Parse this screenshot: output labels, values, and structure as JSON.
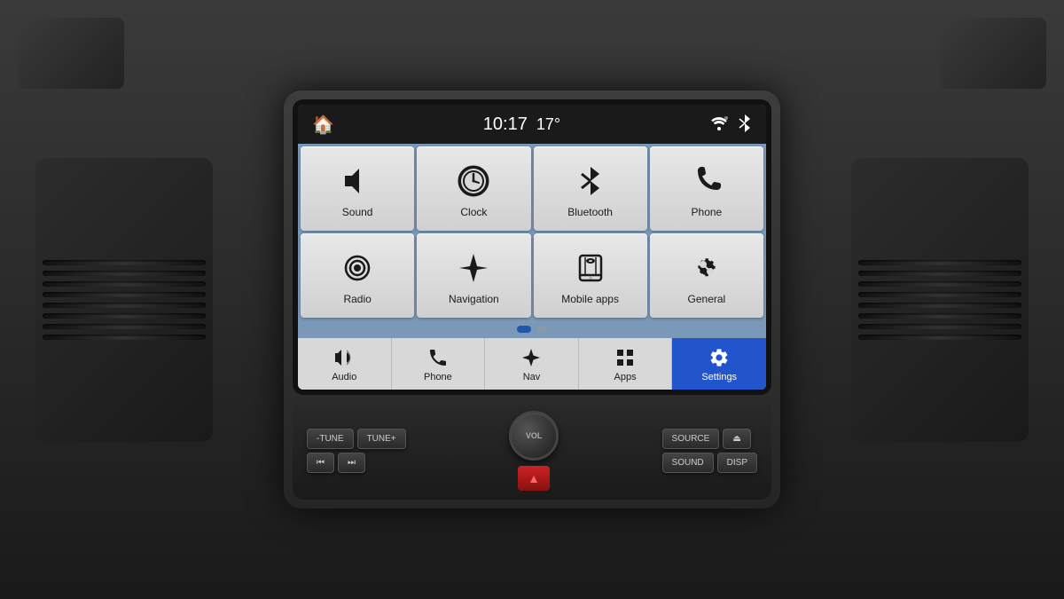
{
  "screen": {
    "header": {
      "home_label": "🏠",
      "time": "10:17",
      "temperature": "17°",
      "wifi_icon": "wifi",
      "bluetooth_icon": "bluetooth"
    },
    "app_grid": {
      "tiles": [
        {
          "id": "sound",
          "label": "Sound",
          "icon": "sound"
        },
        {
          "id": "clock",
          "label": "Clock",
          "icon": "clock"
        },
        {
          "id": "bluetooth",
          "label": "Bluetooth",
          "icon": "bluetooth"
        },
        {
          "id": "phone",
          "label": "Phone",
          "icon": "phone"
        },
        {
          "id": "radio",
          "label": "Radio",
          "icon": "radio"
        },
        {
          "id": "navigation",
          "label": "Navigation",
          "icon": "navigation"
        },
        {
          "id": "mobile-apps",
          "label": "Mobile apps",
          "icon": "mobile-apps"
        },
        {
          "id": "general",
          "label": "General",
          "icon": "general"
        }
      ]
    },
    "pagination": {
      "dots": [
        {
          "active": true
        },
        {
          "active": false
        }
      ]
    },
    "bottom_nav": {
      "items": [
        {
          "id": "audio",
          "label": "Audio",
          "icon": "audio",
          "active": false
        },
        {
          "id": "phone",
          "label": "Phone",
          "icon": "phone-nav",
          "active": false
        },
        {
          "id": "nav",
          "label": "Nav",
          "icon": "nav-star",
          "active": false
        },
        {
          "id": "apps",
          "label": "Apps",
          "icon": "apps-grid",
          "active": false
        },
        {
          "id": "settings",
          "label": "Settings",
          "icon": "settings-gear",
          "active": true
        }
      ]
    }
  },
  "controls": {
    "tune_minus": "-TUNE",
    "tune_plus": "TUNE+",
    "source": "SOURCE",
    "eject": "⏏",
    "prev": "⏮",
    "next": "⏭",
    "sound": "SOUND",
    "disp": "DISP",
    "vol_label": "VOL"
  }
}
